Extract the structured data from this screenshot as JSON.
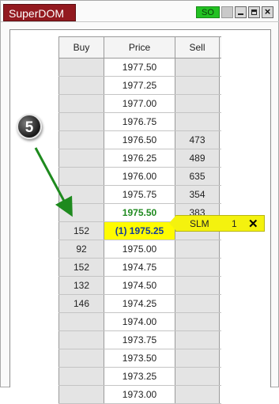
{
  "window": {
    "title": "SuperDOM",
    "status_badge": "SO",
    "close_symbol": "×"
  },
  "columns": {
    "buy": "Buy",
    "price": "Price",
    "sell": "Sell"
  },
  "rows": [
    {
      "buy": "",
      "price": "1977.50",
      "sell": ""
    },
    {
      "buy": "",
      "price": "1977.25",
      "sell": ""
    },
    {
      "buy": "",
      "price": "1977.00",
      "sell": ""
    },
    {
      "buy": "",
      "price": "1976.75",
      "sell": ""
    },
    {
      "buy": "",
      "price": "1976.50",
      "sell": "473"
    },
    {
      "buy": "",
      "price": "1976.25",
      "sell": "489"
    },
    {
      "buy": "",
      "price": "1976.00",
      "sell": "635"
    },
    {
      "buy": "",
      "price": "1975.75",
      "sell": "354"
    },
    {
      "buy": "",
      "price": "1975.50",
      "sell": "383"
    },
    {
      "buy": "152",
      "price": "(1) 1975.25",
      "sell": ""
    },
    {
      "buy": "92",
      "price": "1975.00",
      "sell": ""
    },
    {
      "buy": "152",
      "price": "1974.75",
      "sell": ""
    },
    {
      "buy": "132",
      "price": "1974.50",
      "sell": ""
    },
    {
      "buy": "146",
      "price": "1974.25",
      "sell": ""
    },
    {
      "buy": "",
      "price": "1974.00",
      "sell": ""
    },
    {
      "buy": "",
      "price": "1973.75",
      "sell": ""
    },
    {
      "buy": "",
      "price": "1973.50",
      "sell": ""
    },
    {
      "buy": "",
      "price": "1973.25",
      "sell": ""
    },
    {
      "buy": "",
      "price": "1973.00",
      "sell": ""
    }
  ],
  "order": {
    "type": "SLM",
    "quantity": "1",
    "cancel_symbol": "✕"
  },
  "callout": {
    "number": "5"
  },
  "colors": {
    "title_tab": "#93191f",
    "status_badge": "#22c122",
    "last_traded_price": "#1f8a1f",
    "current_price_highlight": "#fffb00",
    "order_tag": "#f4f20e",
    "arrow": "#1e8a1e"
  }
}
